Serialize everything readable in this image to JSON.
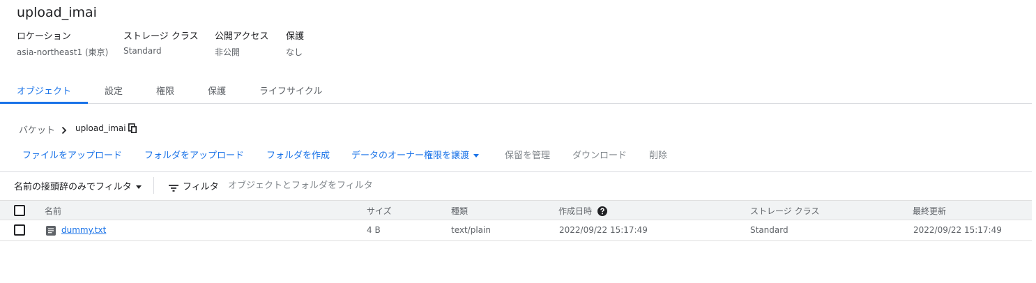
{
  "bucket": {
    "name": "upload_imai",
    "meta": [
      {
        "label": "ロケーション",
        "value": "asia-northeast1 (東京)"
      },
      {
        "label": "ストレージ クラス",
        "value": "Standard"
      },
      {
        "label": "公開アクセス",
        "value": "非公開"
      },
      {
        "label": "保護",
        "value": "なし"
      }
    ]
  },
  "tabs": [
    {
      "label": "オブジェクト",
      "active": true
    },
    {
      "label": "設定"
    },
    {
      "label": "権限"
    },
    {
      "label": "保護"
    },
    {
      "label": "ライフサイクル"
    }
  ],
  "breadcrumb": {
    "root": "バケット",
    "current": "upload_imai"
  },
  "actions": [
    {
      "label": "ファイルをアップロード",
      "enabled": true
    },
    {
      "label": "フォルダをアップロード",
      "enabled": true
    },
    {
      "label": "フォルダを作成",
      "enabled": true
    },
    {
      "label": "データのオーナー権限を譲渡",
      "enabled": true,
      "dropdown": true
    },
    {
      "label": "保留を管理",
      "enabled": false
    },
    {
      "label": "ダウンロード",
      "enabled": false
    },
    {
      "label": "削除",
      "enabled": false
    }
  ],
  "filter": {
    "mode": "名前の接頭辞のみでフィルタ",
    "label": "フィルタ",
    "placeholder": "オブジェクトとフォルダをフィルタ"
  },
  "table": {
    "columns": [
      "名前",
      "サイズ",
      "種類",
      "作成日時",
      "ストレージ クラス",
      "最終更新"
    ],
    "rows": [
      {
        "name": "dummy.txt",
        "size": "4 B",
        "type": "text/plain",
        "created": "2022/09/22 15:17:49",
        "storage_class": "Standard",
        "updated": "2022/09/22 15:17:49"
      }
    ]
  },
  "colors": {
    "accent": "#1a73e8",
    "text": "#202124",
    "muted": "#5f6368",
    "disabled": "#80868b",
    "border": "#dadce0",
    "header_bg": "#f1f3f4"
  },
  "icons": {
    "breadcrumb_separator": "chevron-right-icon",
    "copy": "copy-icon",
    "filter": "filter-icon",
    "help": "help-icon",
    "file": "text-file-icon",
    "dropdown": "caret-down-icon"
  }
}
